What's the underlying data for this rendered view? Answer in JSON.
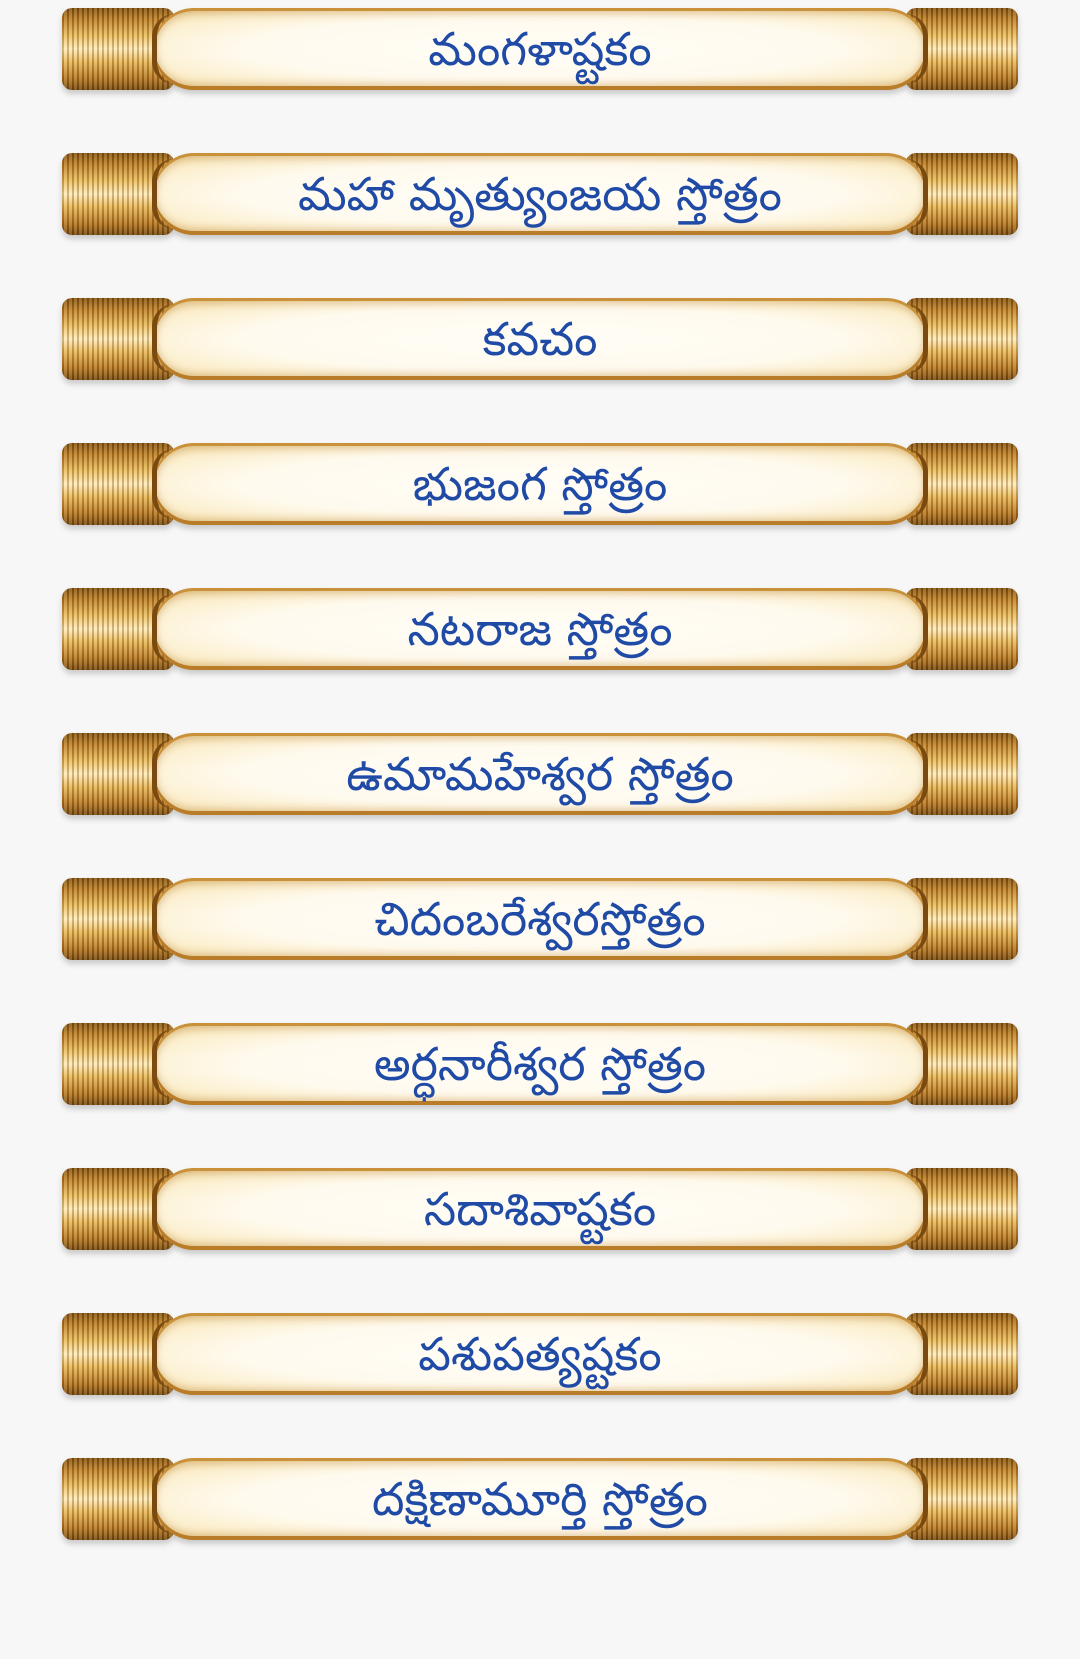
{
  "colors": {
    "background": "#f7f7f7",
    "label_text": "#1f4aa6",
    "scroll_gold": "#c8913a",
    "scroll_paper": "#fffaee"
  },
  "items": [
    {
      "label": "మంగళాష్టకం"
    },
    {
      "label": "మహా మృత్యుంజయ స్తోత్రం"
    },
    {
      "label": "కవచం"
    },
    {
      "label": "భుజంగ స్తోత్రం"
    },
    {
      "label": "నటరాజ స్తోత్రం"
    },
    {
      "label": "ఉమామహేశ్వర స్తోత్రం"
    },
    {
      "label": "చిదంబరేశ్వరస్తోత్రం"
    },
    {
      "label": "అర్ధనారీశ్వర స్తోత్రం"
    },
    {
      "label": "సదాశివాష్టకం"
    },
    {
      "label": "పశుపత్యష్టకం"
    },
    {
      "label": "దక్షిణామూర్తి స్తోత్రం"
    }
  ]
}
